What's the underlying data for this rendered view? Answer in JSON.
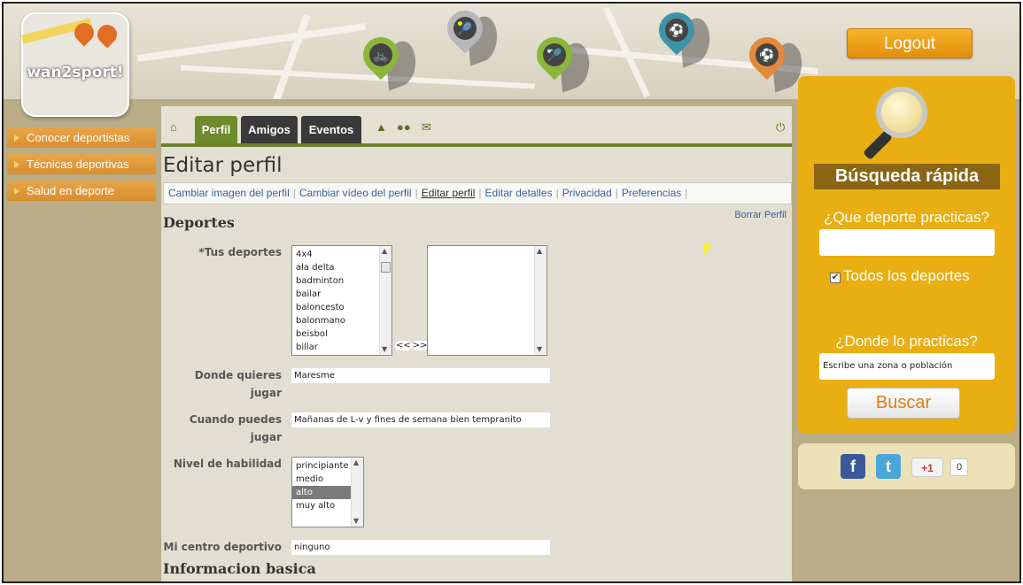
{
  "brand": {
    "logo_text": "wan2sport!"
  },
  "header": {
    "logout_label": "Logout"
  },
  "left_nav": [
    {
      "label": "Conocer deportistas"
    },
    {
      "label": "Técnicas deportivas"
    },
    {
      "label": "Salud en deporte"
    }
  ],
  "tabs": [
    {
      "label": "Perfil"
    },
    {
      "label": "Amigos"
    },
    {
      "label": "Eventos"
    }
  ],
  "page_title": "Editar perfil",
  "subnav": [
    {
      "label": "Cambiar imagen del perfil"
    },
    {
      "label": "Cambiar vídeo del perfil"
    },
    {
      "label": "Editar perfil"
    },
    {
      "label": "Editar detalles"
    },
    {
      "label": "Privacidad"
    },
    {
      "label": "Preferencias"
    }
  ],
  "borrar_label": "Borrar Perfil",
  "section_deportes": "Deportes",
  "section_info": "Informacion basica",
  "form": {
    "tus_deportes_label": "*Tus deportes",
    "sports_options": [
      "4x4",
      "ala delta",
      "badminton",
      "bailar",
      "baloncesto",
      "balonmano",
      "beisbol",
      "billar"
    ],
    "move_left": "<<",
    "move_right": ">>",
    "donde_label_1": "Donde quieres",
    "donde_label_2": "jugar",
    "donde_value": "Maresme",
    "cuando_label_1": "Cuando puedes",
    "cuando_label_2": "jugar",
    "cuando_value": "Mañanas de L-v y fines de semana bien tempranito",
    "nivel_label": "Nivel de habilidad",
    "nivel_options": [
      "principiante",
      "medio",
      "alto",
      "muy alto"
    ],
    "nivel_selected": "alto",
    "centro_label": "Mi centro deportivo",
    "centro_value": "ninguno"
  },
  "search": {
    "title": "Búsqueda rápida",
    "sport_question": "¿Que deporte practicas?",
    "all_sports_label": "Todos los deportes",
    "all_sports_checked": true,
    "where_question": "¿Donde lo practicas?",
    "where_placeholder": "Escribe una zona o población",
    "button_label": "Buscar"
  },
  "social": {
    "facebook": "f",
    "gplus": "+1",
    "gplus_count": "0"
  },
  "colors": {
    "tab_active": "#6e8a2a",
    "tab_inactive": "#3a3a3a",
    "search_panel": "#e9ae12",
    "accent_orange": "#e27b10"
  }
}
